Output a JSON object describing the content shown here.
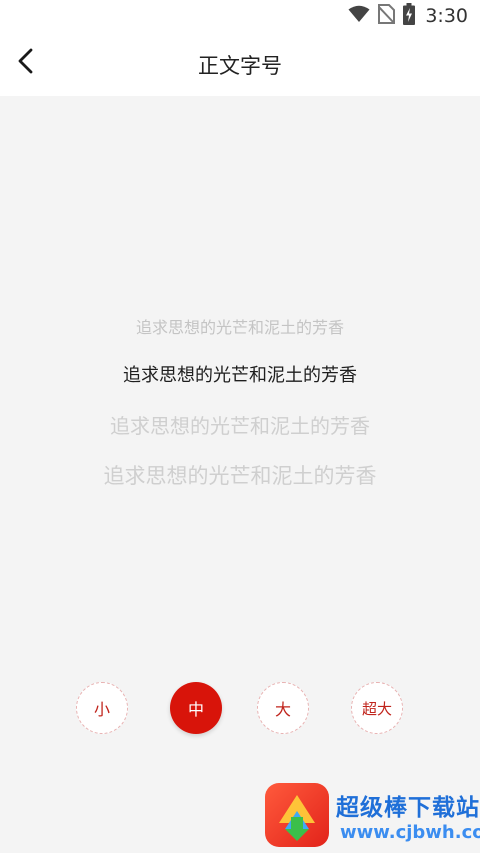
{
  "status_bar": {
    "time": "3:30",
    "icons": [
      "wifi-icon",
      "no-sim-icon",
      "battery-charging-icon"
    ]
  },
  "header": {
    "title": "正文字号",
    "back_icon": "chevron-left-icon"
  },
  "preview": {
    "samples": [
      {
        "size": "small",
        "text": "追求思想的光芒和泥土的芳香",
        "color": "#c4c4c4"
      },
      {
        "size": "medium",
        "text": "追求思想的光芒和泥土的芳香",
        "color": "#1e1e1e"
      },
      {
        "size": "large",
        "text": "追求思想的光芒和泥土的芳香",
        "color": "#cfcfcf"
      },
      {
        "size": "xlarge",
        "text": "追求思想的光芒和泥土的芳香",
        "color": "#cfcfcf"
      }
    ]
  },
  "size_options": [
    {
      "label": "小",
      "selected": false
    },
    {
      "label": "中",
      "selected": true
    },
    {
      "label": "大",
      "selected": false
    },
    {
      "label": "超大",
      "selected": false
    }
  ],
  "colors": {
    "accent": "#d8140a",
    "option_text": "#c0241c",
    "background": "#f4f4f4"
  },
  "watermark": {
    "name": "超级棒下载站",
    "url": "www.cjbwh.com"
  }
}
